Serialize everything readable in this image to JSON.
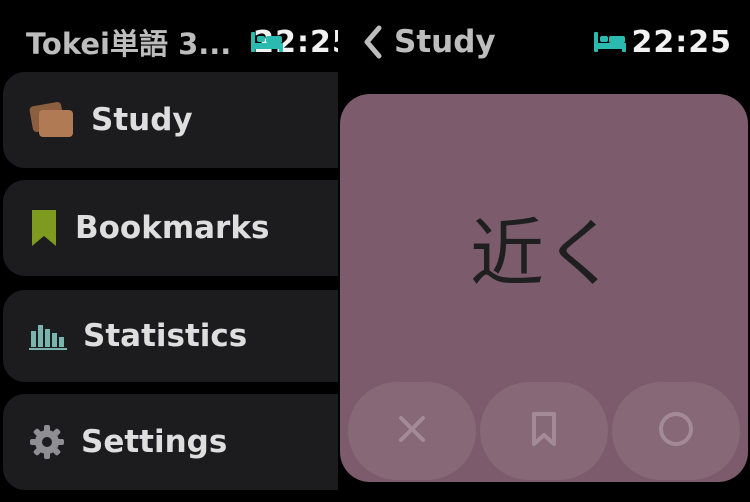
{
  "left": {
    "app_title": "Tokei単語 3...",
    "time": "22:25",
    "menu": [
      {
        "label": "Study",
        "icon": "cards-icon"
      },
      {
        "label": "Bookmarks",
        "icon": "bookmark-icon"
      },
      {
        "label": "Statistics",
        "icon": "bar-chart-icon"
      },
      {
        "label": "Settings",
        "icon": "gear-icon"
      }
    ]
  },
  "right": {
    "nav_title": "Study",
    "time": "22:25",
    "card": {
      "word": "近く",
      "actions": [
        {
          "name": "wrong",
          "icon": "x-icon"
        },
        {
          "name": "bookmark",
          "icon": "bookmark-outline-icon"
        },
        {
          "name": "right",
          "icon": "circle-icon"
        }
      ]
    }
  },
  "colors": {
    "card": "#7b5b6c",
    "card_button": "#866876",
    "sleep_icon": "#2bbab0",
    "study_icon": "#b07a55",
    "bookmark_icon": "#7e9a1f",
    "stats_icon": "#79b4ae"
  }
}
